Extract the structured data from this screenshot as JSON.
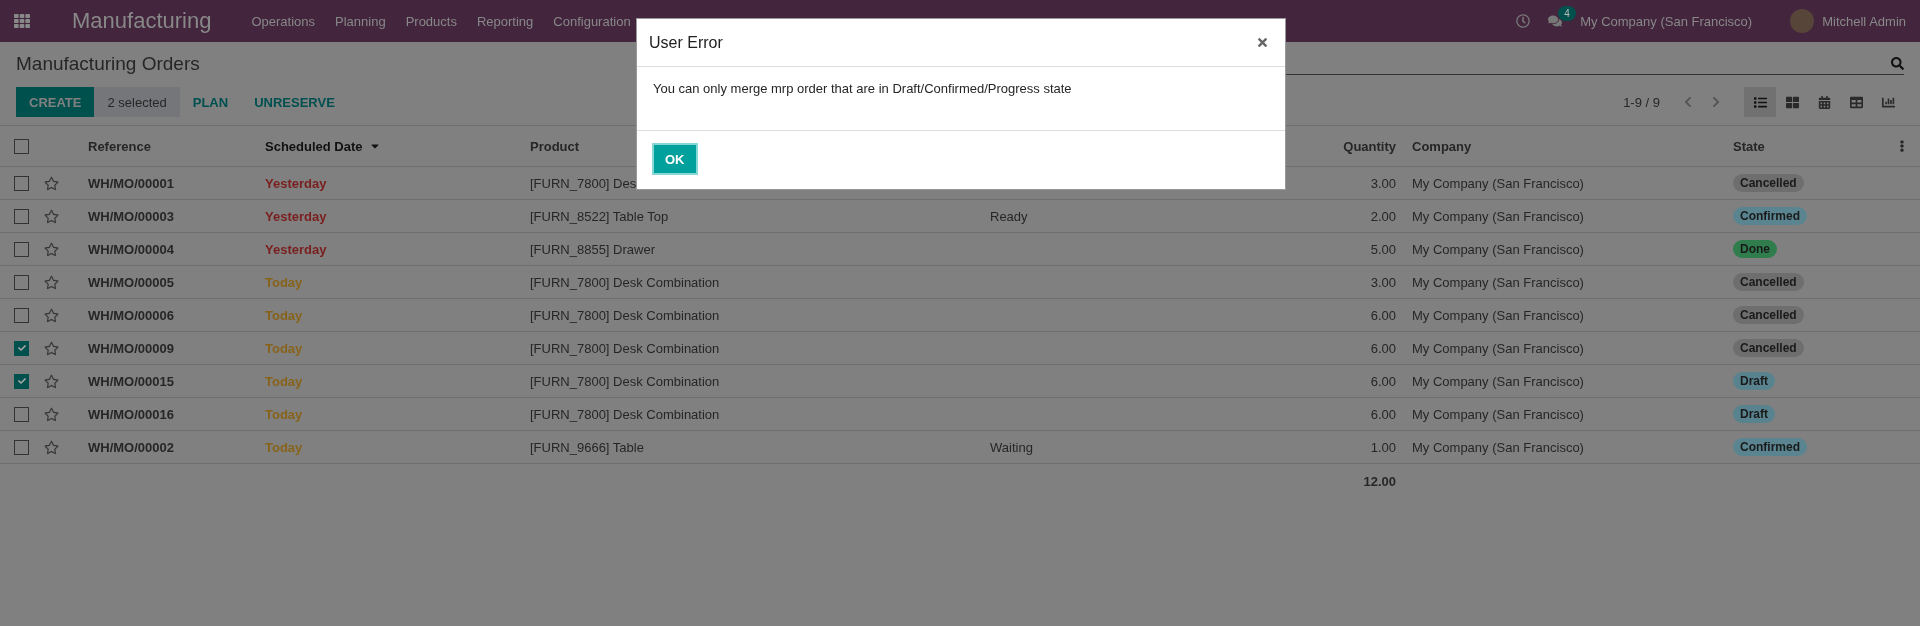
{
  "navbar": {
    "app_name": "Manufacturing",
    "menu": [
      "Operations",
      "Planning",
      "Products",
      "Reporting",
      "Configuration"
    ],
    "message_count": "4",
    "company": "My Company (San Francisco)",
    "user": "Mitchell Admin"
  },
  "control_panel": {
    "title": "Manufacturing Orders",
    "buttons": [
      {
        "label": "CREATE",
        "kind": "primary"
      },
      {
        "label": "2 selected",
        "kind": "counter"
      },
      {
        "label": "PLAN",
        "kind": "link"
      },
      {
        "label": "UNRESERVE",
        "kind": "link"
      }
    ],
    "pager": "1-9 / 9",
    "views": [
      {
        "kind": "list",
        "selected": true
      },
      {
        "kind": "kanban",
        "selected": false
      },
      {
        "kind": "calendar",
        "selected": false
      },
      {
        "kind": "pivot",
        "selected": false
      },
      {
        "kind": "graph",
        "selected": false
      }
    ]
  },
  "table": {
    "select_all": {
      "checked": false
    },
    "columns": [
      {
        "label": "Reference",
        "sorted": false
      },
      {
        "label": "Scheduled Date",
        "sorted": true
      },
      {
        "label": "Product",
        "sorted": false
      },
      {
        "label": "Quantity",
        "sorted": false
      },
      {
        "label": "Company",
        "sorted": false
      },
      {
        "label": "State",
        "sorted": false
      }
    ],
    "rows": [
      {
        "checked": false,
        "reference": "WH/MO/00001",
        "scheduled_date": {
          "text": "Yesterday",
          "kind": "overdue"
        },
        "product": "[FURN_7800] Des",
        "quantity": "3.00",
        "company": "My Company (San Francisco)",
        "state": {
          "label": "Cancelled",
          "color": "#6e6e6e"
        }
      },
      {
        "checked": false,
        "reference": "WH/MO/00003",
        "scheduled_date": {
          "text": "Yesterday",
          "kind": "overdue"
        },
        "product": "[FURN_8522] Table Top",
        "column_4": "Ready",
        "quantity": "2.00",
        "company": "My Company (San Francisco)",
        "state": {
          "label": "Confirmed",
          "color": "#5a8590"
        }
      },
      {
        "checked": false,
        "reference": "WH/MO/00004",
        "scheduled_date": {
          "text": "Yesterday",
          "kind": "overdue"
        },
        "product": "[FURN_8855] Drawer",
        "quantity": "5.00",
        "company": "My Company (San Francisco)",
        "state": {
          "label": "Done",
          "color": "#2f7d4c"
        }
      },
      {
        "checked": false,
        "reference": "WH/MO/00005",
        "scheduled_date": {
          "text": "Today",
          "kind": "today"
        },
        "product": "[FURN_7800] Desk Combination",
        "quantity": "3.00",
        "company": "My Company (San Francisco)",
        "state": {
          "label": "Cancelled",
          "color": "#6e6e6e"
        }
      },
      {
        "checked": false,
        "reference": "WH/MO/00006",
        "scheduled_date": {
          "text": "Today",
          "kind": "today"
        },
        "product": "[FURN_7800] Desk Combination",
        "quantity": "6.00",
        "company": "My Company (San Francisco)",
        "state": {
          "label": "Cancelled",
          "color": "#6e6e6e"
        }
      },
      {
        "checked": true,
        "reference": "WH/MO/00009",
        "scheduled_date": {
          "text": "Today",
          "kind": "today"
        },
        "product": "[FURN_7800] Desk Combination",
        "quantity": "6.00",
        "company": "My Company (San Francisco)",
        "state": {
          "label": "Cancelled",
          "color": "#6e6e6e"
        }
      },
      {
        "checked": true,
        "reference": "WH/MO/00015",
        "scheduled_date": {
          "text": "Today",
          "kind": "today"
        },
        "product": "[FURN_7800] Desk Combination",
        "quantity": "6.00",
        "company": "My Company (San Francisco)",
        "state": {
          "label": "Draft",
          "color": "#58838e"
        }
      },
      {
        "checked": false,
        "reference": "WH/MO/00016",
        "scheduled_date": {
          "text": "Today",
          "kind": "today"
        },
        "product": "[FURN_7800] Desk Combination",
        "quantity": "6.00",
        "company": "My Company (San Francisco)",
        "state": {
          "label": "Draft",
          "color": "#58838e"
        }
      },
      {
        "checked": false,
        "reference": "WH/MO/00002",
        "scheduled_date": {
          "text": "Today",
          "kind": "today"
        },
        "product": "[FURN_9666] Table",
        "column_4": "Waiting",
        "quantity": "1.00",
        "company": "My Company (San Francisco)",
        "state": {
          "label": "Confirmed",
          "color": "#5a8590"
        }
      }
    ],
    "total_quantity": "12.00"
  },
  "dialog": {
    "title": "User Error",
    "message": "You can only merge mrp order that are in Draft/Confirmed/Progress state",
    "buttons": [
      "OK"
    ]
  }
}
